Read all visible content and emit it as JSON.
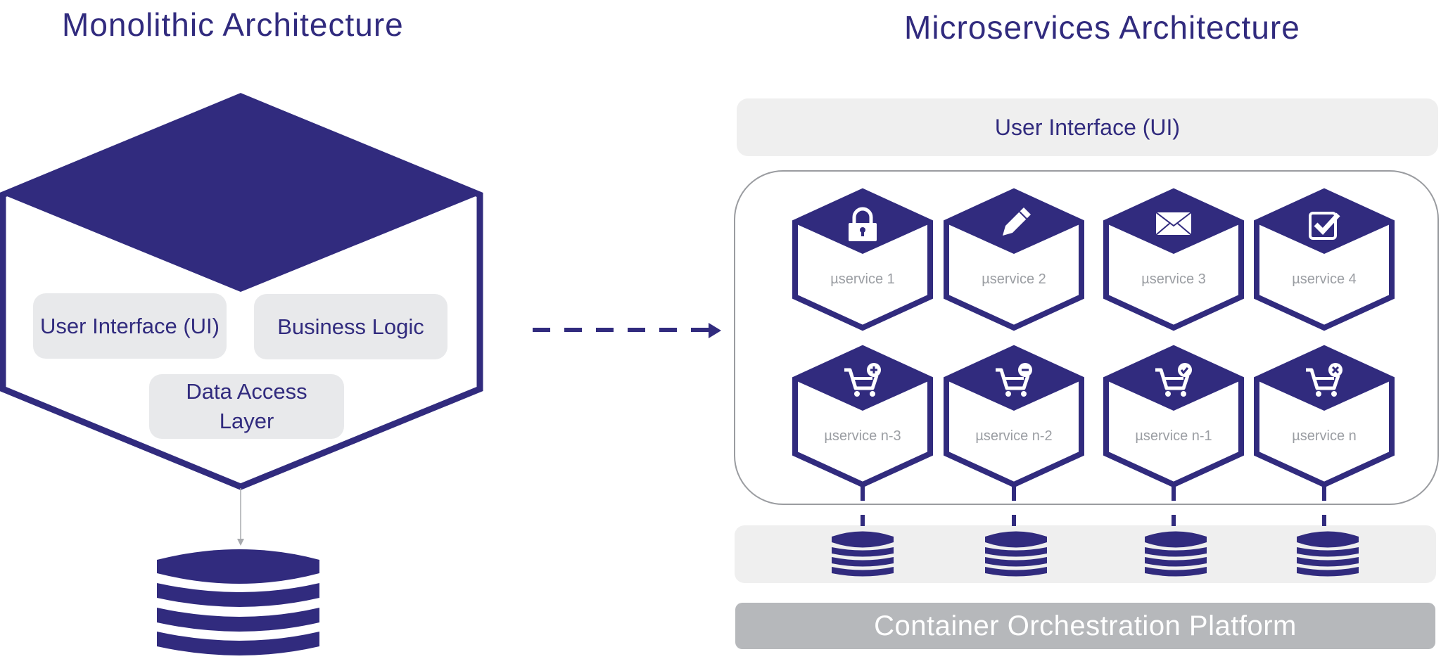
{
  "colors": {
    "primary": "#312b7e",
    "layer_box": "#e8e9eb",
    "band": "#efefef",
    "platform": "#b6b8bb",
    "service_label": "#9b9ea3",
    "connector": "#9a9ca0"
  },
  "monolith": {
    "title": "Monolithic Architecture",
    "layers": {
      "ui": "User Interface (UI)",
      "business": "Business Logic",
      "data_access": "Data Access Layer"
    },
    "database_icon": "database-icon"
  },
  "transition_arrow": "dashed-arrow-right",
  "microservices": {
    "title": "Microservices Architecture",
    "ui_layer": "User Interface (UI)",
    "services": [
      {
        "label": "µservice 1",
        "icon": "lock-icon"
      },
      {
        "label": "µservice 2",
        "icon": "pencil-icon"
      },
      {
        "label": "µservice 3",
        "icon": "envelope-icon"
      },
      {
        "label": "µservice 4",
        "icon": "checkbox-icon"
      },
      {
        "label": "µservice n-3",
        "icon": "cart-add-icon"
      },
      {
        "label": "µservice n-2",
        "icon": "cart-remove-icon"
      },
      {
        "label": "µservice n-1",
        "icon": "cart-check-icon"
      },
      {
        "label": "µservice n",
        "icon": "cart-cancel-icon"
      }
    ],
    "databases": [
      "database-icon",
      "database-icon",
      "database-icon",
      "database-icon"
    ],
    "platform": "Container Orchestration Platform"
  }
}
